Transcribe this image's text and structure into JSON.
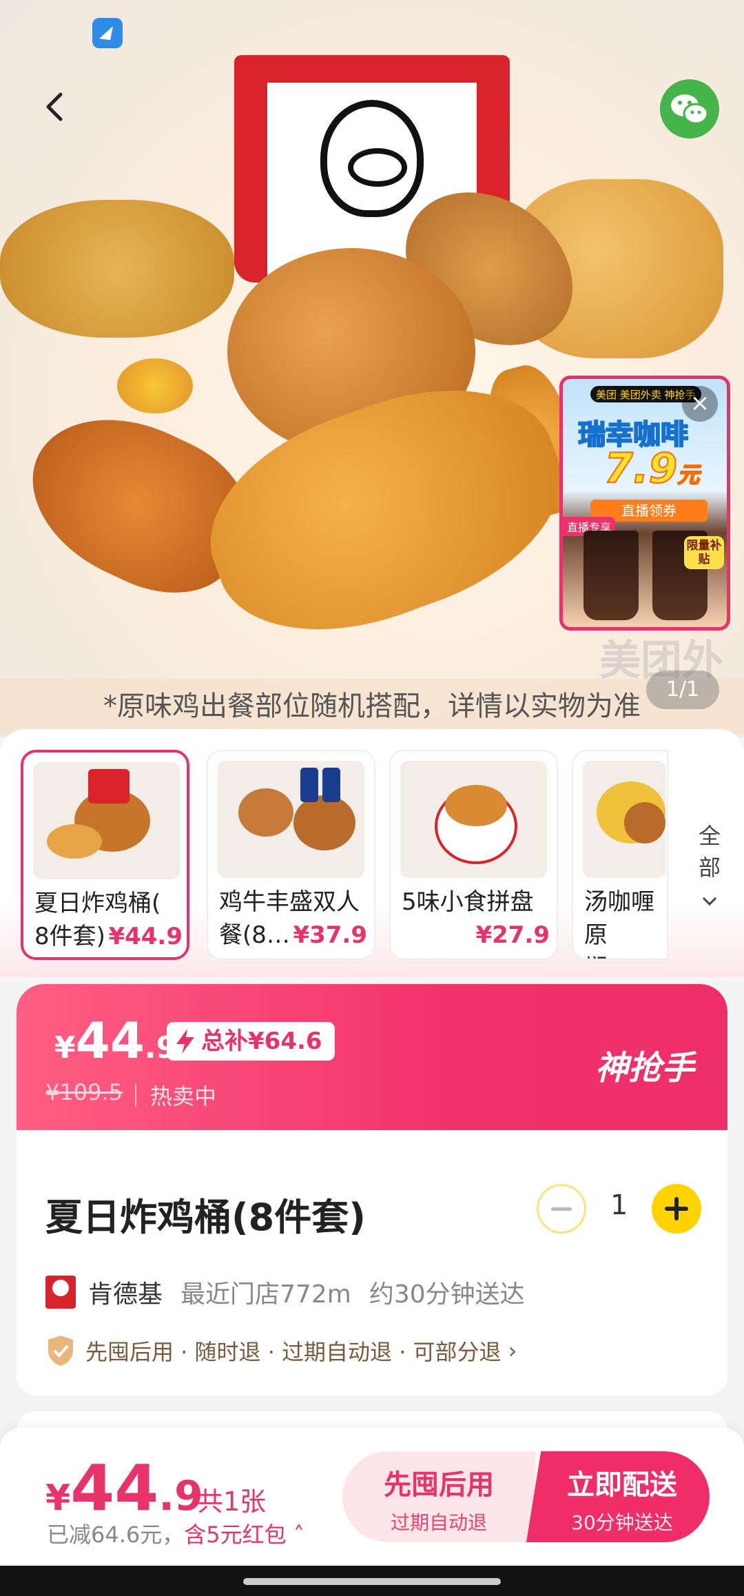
{
  "hero": {
    "caption": "*原味鸡出餐部位随机搭配，详情以实物为准",
    "page_indicator": "1/1",
    "watermark": "美团外",
    "promo": {
      "top_label": "美团 美团外卖 神抢手",
      "title": "瑞幸咖啡",
      "price": "7.9",
      "price_unit": "元",
      "ribbon": "直播领券",
      "tag": "直播专享",
      "limited": "限量补贴"
    }
  },
  "products": [
    {
      "name_line1": "夏日炸鸡桶(",
      "name_line2": "8件套)",
      "price": "¥44.9",
      "selected": true
    },
    {
      "name_line1": "鸡牛丰盛双人",
      "name_line2": "餐(8…",
      "price": "¥37.9",
      "selected": false
    },
    {
      "name_line1": "5味小食拼盘",
      "name_line2": "",
      "price": "¥27.9",
      "selected": false
    },
    {
      "name_line1": "汤咖喱原",
      "name_line2": "焖拌…",
      "price": "¥",
      "selected": false
    }
  ],
  "all_button": {
    "line1": "全",
    "line2": "部",
    "icon": "chevron-down"
  },
  "price_banner": {
    "symbol": "¥",
    "int": "44",
    "dec": ".9",
    "subsidy": "总补¥64.6",
    "original_price": "¥109.5",
    "status": "热卖中",
    "brand": "神抢手"
  },
  "product": {
    "title": "夏日炸鸡桶(8件套)",
    "quantity": "1",
    "store_name": "肯德基",
    "store_distance": "最近门店772m",
    "delivery_time": "约30分钟送达",
    "policy": "先囤后用 · 随时退 · 过期自动退 · 可部分退"
  },
  "bottom_bar": {
    "symbol": "¥",
    "int": "44",
    "dec": ".9",
    "count": "共1张",
    "saved_prefix": "已减64.6元，",
    "saved_highlight": "含5元红包",
    "paylater_main": "先囤后用",
    "paylater_sub": "过期自动退",
    "deliver_main": "立即配送",
    "deliver_sub": "30分钟送达"
  },
  "colors": {
    "accent": "#e8336a",
    "yellow": "#ffd200",
    "wechat": "#44b549"
  }
}
